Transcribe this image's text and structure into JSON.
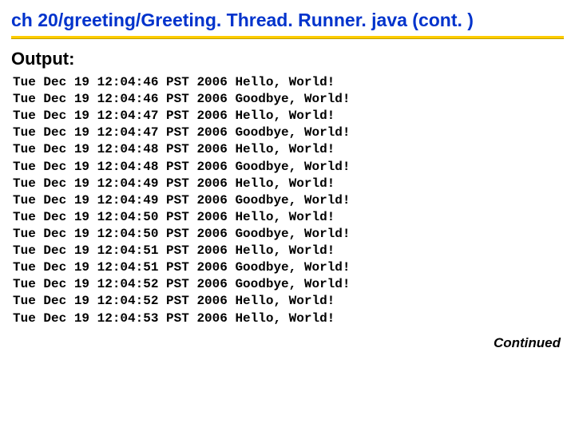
{
  "title": "ch 20/greeting/Greeting. Thread. Runner. java  (cont. )",
  "subtitle": "Output:",
  "continued": "Continued",
  "lines": [
    "Tue Dec 19 12:04:46 PST 2006 Hello, World!",
    "Tue Dec 19 12:04:46 PST 2006 Goodbye, World!",
    "Tue Dec 19 12:04:47 PST 2006 Hello, World!",
    "Tue Dec 19 12:04:47 PST 2006 Goodbye, World!",
    "Tue Dec 19 12:04:48 PST 2006 Hello, World!",
    "Tue Dec 19 12:04:48 PST 2006 Goodbye, World!",
    "Tue Dec 19 12:04:49 PST 2006 Hello, World!",
    "Tue Dec 19 12:04:49 PST 2006 Goodbye, World!",
    "Tue Dec 19 12:04:50 PST 2006 Hello, World!",
    "Tue Dec 19 12:04:50 PST 2006 Goodbye, World!",
    "Tue Dec 19 12:04:51 PST 2006 Hello, World!",
    "Tue Dec 19 12:04:51 PST 2006 Goodbye, World!",
    "Tue Dec 19 12:04:52 PST 2006 Goodbye, World!",
    "Tue Dec 19 12:04:52 PST 2006 Hello, World!",
    "Tue Dec 19 12:04:53 PST 2006 Hello, World!"
  ]
}
